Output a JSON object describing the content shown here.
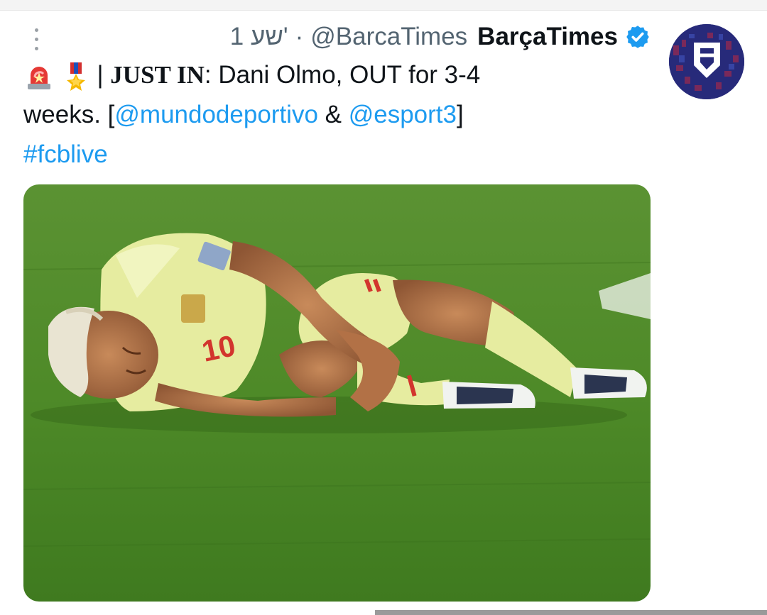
{
  "tweet": {
    "time": "1 שע'",
    "separator": "·",
    "handle": "@BarcaTimes",
    "display_name": "BarçaTimes",
    "text": {
      "pipe": "|",
      "just_in": "JUST IN",
      "after_just_in": ": Dani Olmo, OUT for 3-4",
      "line2_start": "weeks. [",
      "mention1": "@mundodeportivo",
      "amp": " & ",
      "mention2": "@esport3",
      "line2_end": "]",
      "hashtag": "#fcblive"
    },
    "emojis": [
      "rotating-light",
      "military-medal"
    ],
    "colors": {
      "link": "#1d9bf0",
      "meta": "#536471",
      "verified": "#1d9bf0",
      "avatar_bg": "#272a7a"
    }
  }
}
